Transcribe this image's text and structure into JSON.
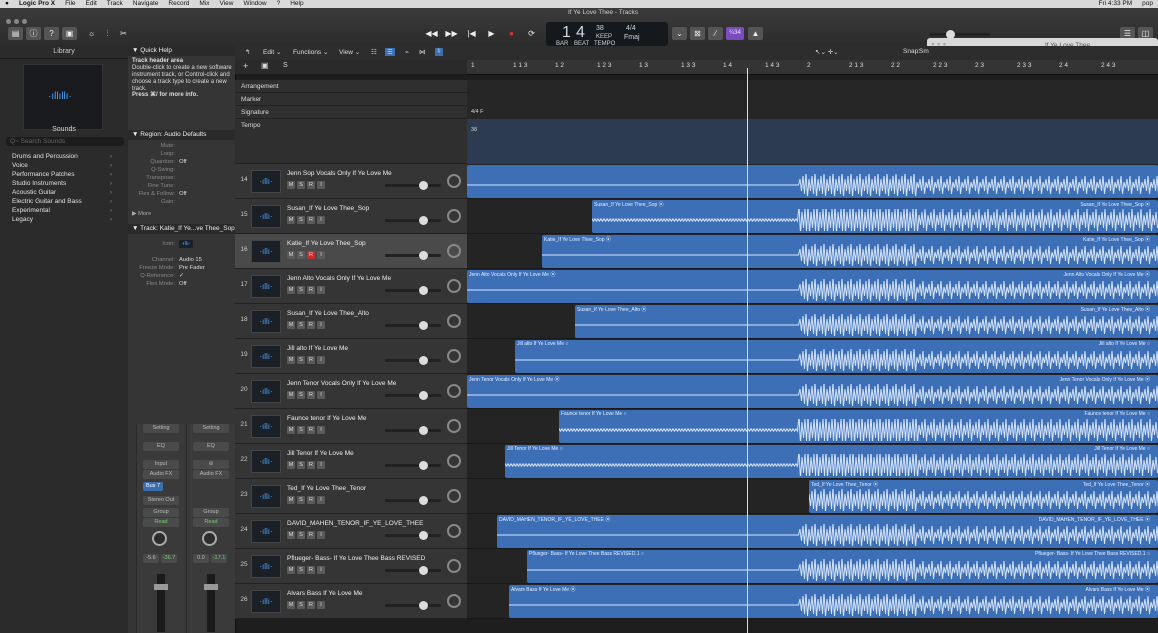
{
  "menubar": {
    "app": "Logic Pro X",
    "items": [
      "File",
      "Edit",
      "Track",
      "Navigate",
      "Record",
      "Mix",
      "View",
      "Window",
      "?",
      "Help"
    ],
    "clock": "Fri 4:33 PM",
    "user": "pop"
  },
  "window": {
    "title": "If Ye Love Thee - Tracks"
  },
  "lcd": {
    "bar": "1",
    "beat": "4",
    "tempo": "38",
    "tempo_label": "KEEP",
    "sig": "4/4",
    "key": "Fmaj",
    "bar_label": "BAR",
    "beat_label": "BEAT",
    "tempo_sub": "TEMPO"
  },
  "cpu_badge": "¼34",
  "popup_title": "If Ye Love Thee",
  "library": {
    "title": "Library",
    "sounds_label": "Sounds",
    "search_placeholder": "Q~ Search Sounds",
    "items": [
      "Drums and Percussion",
      "Voice",
      "Performance Patches",
      "Studio Instruments",
      "Acoustic Guitar",
      "Electric Guitar and Bass",
      "Experimental",
      "Legacy"
    ]
  },
  "inspector": {
    "quick_help_title": "▼ Quick Help",
    "quick_help_heading": "Track header area",
    "quick_help_text": "Double-click to create a new software instrument track, or Control-click and choose a track type to create a new track.",
    "quick_help_more": "Press ⌘/ for more info.",
    "region_header": "▼ Region: Audio Defaults",
    "region_params": [
      {
        "k": "Mute:",
        "v": ""
      },
      {
        "k": "Loop:",
        "v": ""
      },
      {
        "k": "Quantize:",
        "v": "Off"
      },
      {
        "k": "Q-Swing:",
        "v": ""
      },
      {
        "k": "Transpose:",
        "v": ""
      },
      {
        "k": "Fine Tune:",
        "v": ""
      },
      {
        "k": "Flex & Follow:",
        "v": "Off"
      },
      {
        "k": "Gain:",
        "v": ""
      }
    ],
    "more_label": "▶ More",
    "track_header": "▼ Track: Katie_If Ye...ve Thee_Sop",
    "icon_label": "Icon:",
    "track_params": [
      {
        "k": "Channel:",
        "v": "Audio 15"
      },
      {
        "k": "Freeze Mode:",
        "v": "Pre Fader"
      },
      {
        "k": "Q-Reference:",
        "v": "✓"
      },
      {
        "k": "Flex Mode:",
        "v": "Off"
      }
    ],
    "strip1": {
      "setting": "Setting",
      "eq": "EQ",
      "input": "Input",
      "fx": "Audio FX",
      "bus": "Bus 7",
      "out": "Stereo Out",
      "group": "Group",
      "read": "Read",
      "vol": "-5.6",
      "peak": "-36.7"
    },
    "strip2": {
      "setting": "Setting",
      "eq": "EQ",
      "input": "⊚",
      "fx": "Audio FX",
      "bus": "",
      "out": "",
      "group": "Group",
      "read": "Read",
      "vol": "0.0",
      "peak": "-17.1"
    }
  },
  "toolbar": {
    "edit": "Edit ⌄",
    "functions": "Functions ⌄",
    "view": "View ⌄",
    "snap": "Snap:",
    "snap_val": "Sm"
  },
  "ruler": [
    "1",
    "1 1 3",
    "1 2",
    "1 2 3",
    "1 3",
    "1 3 3",
    "1 4",
    "1 4 3",
    "2",
    "2 1 3",
    "2 2",
    "2 2 3",
    "2 3",
    "2 3 3",
    "2 4",
    "2 4 3"
  ],
  "globals": [
    "Arrangement",
    "Marker",
    "Signature",
    "Tempo"
  ],
  "signature_value": "4/4 F",
  "tempo_value": "38",
  "tracks": [
    {
      "num": "14",
      "name": "Jenn Sop Vocals Only If Ye Love Me",
      "region": ""
    },
    {
      "num": "15",
      "name": "Susan_If Ye Love Thee_Sop",
      "region": "Susan_If Ye Love Thee_Sop ⦿"
    },
    {
      "num": "16",
      "name": "Katie_If Ye Love Thee_Sop",
      "region": "Katie_If Ye Love Thee_Sop ⦿"
    },
    {
      "num": "17",
      "name": "Jenn Alto Vocals Only If Ye Love Me",
      "region": "Jenn Alto Vocals Only If Ye Love Me ⦿"
    },
    {
      "num": "18",
      "name": "Susan_If Ye Love Thee_Alto",
      "region": "Susan_If Ye Love Thee_Alto ⦿"
    },
    {
      "num": "19",
      "name": "Jill alto If Ye Love Me",
      "region": "Jill alto If Ye Love Me ○"
    },
    {
      "num": "20",
      "name": "Jenn Tenor Vocals Only If Ye Love Me",
      "region": "Jenn Tenor Vocals Only If Ye Love Me ⦿"
    },
    {
      "num": "21",
      "name": "Faunce tenor If Ye Love Me",
      "region": "Faunce tenor If Ye Love Me ○"
    },
    {
      "num": "22",
      "name": "Jill Tenor If Ye Love Me",
      "region": "Jill Tenor If Ye Love Me ○"
    },
    {
      "num": "23",
      "name": "Ted_If Ye Love Thee_Tenor",
      "region": "Ted_If Ye Love Thee_Tenor ⦿"
    },
    {
      "num": "24",
      "name": "DAVID_MAHEN_TENOR_IF_YE_LOVE_THEE",
      "region": "DAVID_MAHEN_TENOR_IF_YE_LOVE_THEE ⦿"
    },
    {
      "num": "25",
      "name": "Pflueger- Bass- If Ye Love Thee Bass REVISED",
      "region": "Pflueger- Bass- If Ye Love Thee Bass REVISED.1 ○"
    },
    {
      "num": "26",
      "name": "Alvars Bass If Ye Love Me",
      "region": "Alvars Bass If Ye Love Me ⦿"
    }
  ],
  "track_buttons": [
    "M",
    "S",
    "R",
    "I"
  ],
  "colors": {
    "region": "#3c6fb6",
    "accent": "#4aa3ff",
    "record": "#c03030"
  }
}
